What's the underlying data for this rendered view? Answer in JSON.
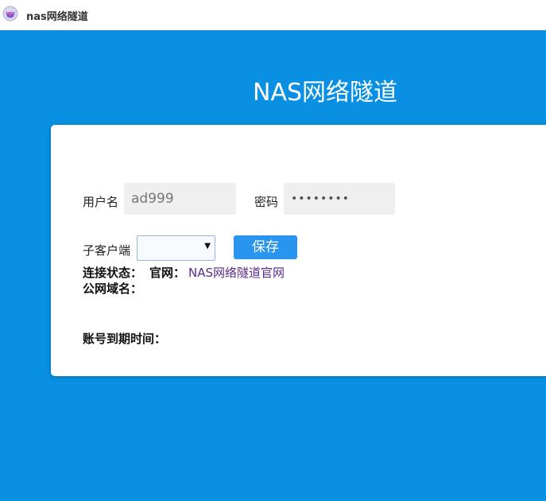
{
  "titlebar": {
    "app_name": "nas网络隧道",
    "logo_icon": "nas-app-logo"
  },
  "main": {
    "heading": "NAS网络隧道",
    "background_color": "#0a90e2"
  },
  "form": {
    "username_label": "用户名",
    "username_value": "ad999",
    "password_label": "密码",
    "password_value": "••••••••",
    "client_label": "子客户端",
    "client_selected": "",
    "save_label": "保存",
    "status_label": "连接状态：",
    "website_label": "官网：",
    "website_link": "NAS网络隧道官网",
    "domain_label": "公网域名：",
    "expiry_label": "账号到期时间："
  }
}
